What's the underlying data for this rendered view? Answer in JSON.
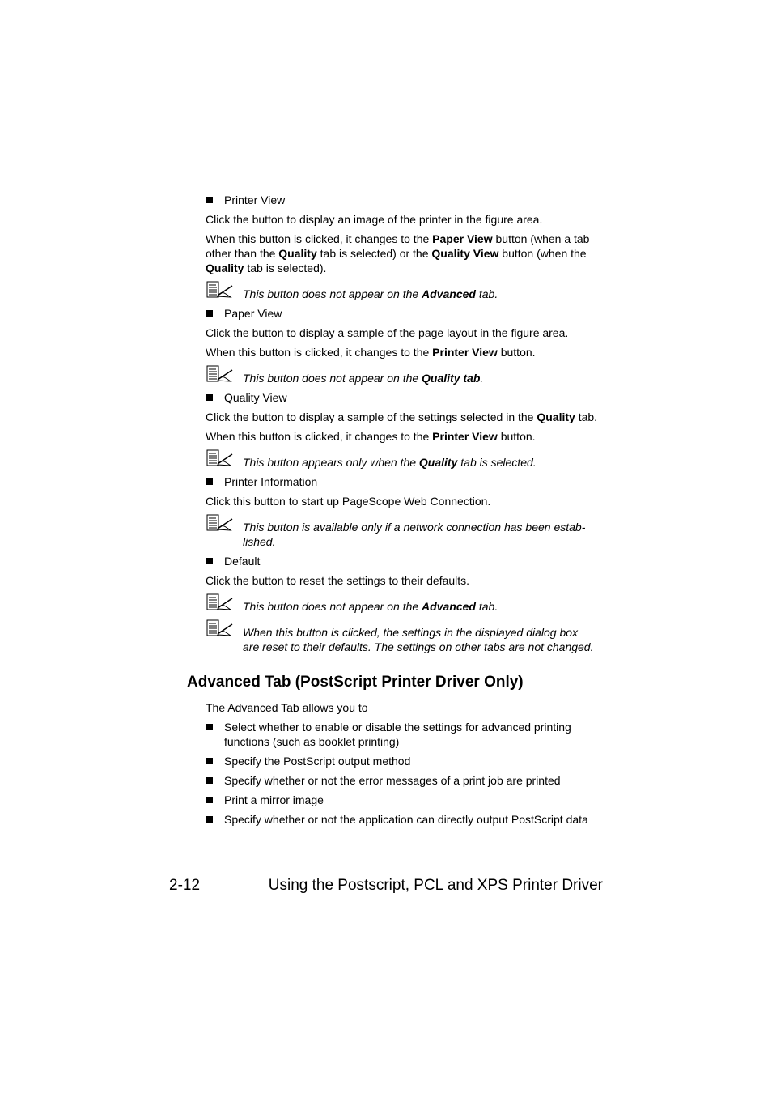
{
  "sections": {
    "printer_view": {
      "bullet": "Printer View",
      "p1": "Click the button to display an image of the printer in the figure area.",
      "p2": {
        "a": "When this button is clicked, it changes to the ",
        "b1": "Paper View",
        "c": " button (when a tab",
        "d": "other than the ",
        "b2": "Quality",
        "e": " tab is selected) or the ",
        "b3": "Quality View",
        "f": " button (when the",
        "b4": "Quality",
        "g": " tab is selected)."
      },
      "note": {
        "a": "This button does not appear on the ",
        "b": "Advanced",
        "c": " tab."
      }
    },
    "paper_view": {
      "bullet": "Paper View",
      "p1": "Click the button to display a sample of the page layout in the figure area.",
      "p2": {
        "a": "When this button is clicked, it changes to the ",
        "b": "Printer View",
        "c": " button."
      },
      "note": {
        "a": "This button does not appear on the ",
        "b": "Quality tab",
        "c": "."
      }
    },
    "quality_view": {
      "bullet": "Quality View",
      "p1": {
        "a": "Click the button to display a sample of the settings selected in the ",
        "b": "Quality",
        "c": " tab."
      },
      "p2": {
        "a": "When this button is clicked, it changes to the ",
        "b": "Printer View",
        "c": " button."
      },
      "note": {
        "a": "This button appears only when the ",
        "b": "Quality",
        "c": " tab is selected."
      }
    },
    "printer_information": {
      "bullet": "Printer Information",
      "p1": "Click this button to start up PageScope Web Connection.",
      "note_line1": "This button is available only if a network connection has been estab-",
      "note_line2": "lished."
    },
    "default": {
      "bullet": "Default",
      "p1": "Click the button to reset the settings to their defaults.",
      "note1": {
        "a": "This button does not appear on the ",
        "b": "Advanced",
        "c": " tab."
      },
      "note2_line1": "When this button is clicked, the settings in the displayed dialog box",
      "note2_line2": "are reset to their defaults. The settings on other tabs are not changed."
    }
  },
  "advanced": {
    "heading": "Advanced Tab (PostScript Printer Driver Only)",
    "intro": "The Advanced Tab allows you to",
    "items": [
      {
        "line1": "Select whether to enable or disable the settings for advanced printing",
        "line2": "functions (such as booklet printing)"
      },
      {
        "line1": "Specify the PostScript output method"
      },
      {
        "line1": "Specify whether or not the error messages of a print job are printed"
      },
      {
        "line1": "Print a mirror image"
      },
      {
        "line1": "Specify whether or not the application can directly output PostScript data"
      }
    ]
  },
  "footer": {
    "page_number": "2-12",
    "title": "Using the Postscript, PCL and XPS Printer Driver"
  },
  "icons": {
    "note": "note-pencil-icon",
    "bullet": "square-bullet-icon"
  }
}
